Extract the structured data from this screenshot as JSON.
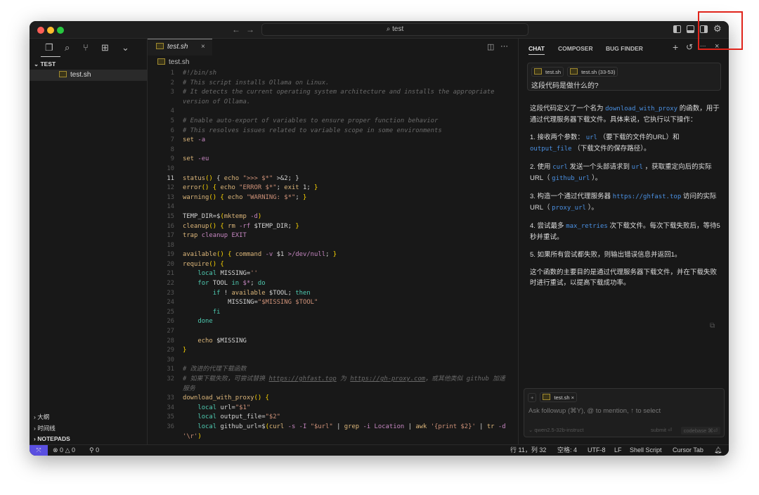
{
  "titlebar": {
    "search": "test",
    "search_icon": "search-icon"
  },
  "sidebar": {
    "section": "TEST",
    "file": "test.sh",
    "bottom": [
      "大纲",
      "时间线",
      "NOTEPADS"
    ]
  },
  "editor": {
    "tab": "test.sh",
    "breadcrumb": "test.sh",
    "current_line": 11,
    "lines": [
      {
        "n": 1,
        "t": [
          [
            "c",
            "#!/bin/sh"
          ]
        ]
      },
      {
        "n": 2,
        "t": [
          [
            "c",
            "# This script installs Ollama on Linux."
          ]
        ]
      },
      {
        "n": 3,
        "t": [
          [
            "c",
            "# It detects the current operating system architecture and installs the appropriate version of Ollama."
          ]
        ]
      },
      {
        "n": 4,
        "t": []
      },
      {
        "n": 5,
        "t": [
          [
            "c",
            "# Enable auto-export of variables to ensure proper function behavior"
          ]
        ]
      },
      {
        "n": 6,
        "t": [
          [
            "c",
            "# This resolves issues related to variable scope in some environments"
          ]
        ]
      },
      {
        "n": 7,
        "t": [
          [
            "f",
            "set "
          ],
          [
            "k",
            "-a"
          ]
        ]
      },
      {
        "n": 8,
        "t": []
      },
      {
        "n": 9,
        "t": [
          [
            "f",
            "set "
          ],
          [
            "k",
            "-eu"
          ]
        ]
      },
      {
        "n": 10,
        "t": []
      },
      {
        "n": 11,
        "t": [
          [
            "f",
            "status"
          ],
          [
            "b",
            "()"
          ],
          [
            "p",
            " { "
          ],
          [
            "f",
            "echo "
          ],
          [
            "s",
            "\">>> $*\""
          ],
          [
            "p",
            " >&2; }"
          ]
        ]
      },
      {
        "n": 12,
        "t": [
          [
            "f",
            "error"
          ],
          [
            "b",
            "()"
          ],
          [
            "b",
            " { "
          ],
          [
            "f",
            "echo "
          ],
          [
            "s",
            "\"ERROR $*\""
          ],
          [
            "p",
            "; "
          ],
          [
            "f",
            "exit "
          ],
          [
            "p",
            "1; "
          ],
          [
            "b",
            "}"
          ]
        ]
      },
      {
        "n": 13,
        "t": [
          [
            "f",
            "warning"
          ],
          [
            "b",
            "()"
          ],
          [
            "b",
            " { "
          ],
          [
            "f",
            "echo "
          ],
          [
            "s",
            "\"WARNING: $*\""
          ],
          [
            "p",
            "; "
          ],
          [
            "b",
            "}"
          ]
        ]
      },
      {
        "n": 14,
        "t": []
      },
      {
        "n": 15,
        "t": [
          [
            "p",
            "TEMP_DIR=$"
          ],
          [
            "b",
            "("
          ],
          [
            "f",
            "mktemp "
          ],
          [
            "k",
            "-d"
          ],
          [
            "b",
            ")"
          ]
        ]
      },
      {
        "n": 16,
        "t": [
          [
            "f",
            "cleanup"
          ],
          [
            "b",
            "()"
          ],
          [
            "b",
            " { "
          ],
          [
            "f",
            "rm "
          ],
          [
            "k",
            "-rf "
          ],
          [
            "p",
            "$TEMP_DIR; "
          ],
          [
            "b",
            "}"
          ]
        ]
      },
      {
        "n": 17,
        "t": [
          [
            "f",
            "trap "
          ],
          [
            "k",
            "cleanup EXIT"
          ]
        ]
      },
      {
        "n": 18,
        "t": []
      },
      {
        "n": 19,
        "t": [
          [
            "f",
            "available"
          ],
          [
            "b",
            "()"
          ],
          [
            "b",
            " { "
          ],
          [
            "f",
            "command "
          ],
          [
            "k",
            "-v "
          ],
          [
            "p",
            "$1 "
          ],
          [
            "k",
            ">/dev/null"
          ],
          [
            "p",
            "; "
          ],
          [
            "b",
            "}"
          ]
        ]
      },
      {
        "n": 20,
        "t": [
          [
            "f",
            "require"
          ],
          [
            "b",
            "()"
          ],
          [
            "b",
            " {"
          ]
        ]
      },
      {
        "n": 21,
        "t": [
          [
            "p",
            "    "
          ],
          [
            "t",
            "local "
          ],
          [
            "p",
            "MISSING="
          ],
          [
            "s",
            "''"
          ]
        ]
      },
      {
        "n": 22,
        "t": [
          [
            "p",
            "    "
          ],
          [
            "t",
            "for "
          ],
          [
            "p",
            "TOOL "
          ],
          [
            "t",
            "in "
          ],
          [
            "k",
            "$*"
          ],
          [
            "p",
            "; "
          ],
          [
            "t",
            "do"
          ]
        ]
      },
      {
        "n": 23,
        "t": [
          [
            "p",
            "        "
          ],
          [
            "t",
            "if "
          ],
          [
            "p",
            "! "
          ],
          [
            "f",
            "available "
          ],
          [
            "p",
            "$TOOL; "
          ],
          [
            "t",
            "then"
          ]
        ]
      },
      {
        "n": 24,
        "t": [
          [
            "p",
            "            MISSING="
          ],
          [
            "s",
            "\"$MISSING $TOOL\""
          ]
        ]
      },
      {
        "n": 25,
        "t": [
          [
            "p",
            "        "
          ],
          [
            "t",
            "fi"
          ]
        ]
      },
      {
        "n": 26,
        "t": [
          [
            "p",
            "    "
          ],
          [
            "t",
            "done"
          ]
        ]
      },
      {
        "n": 27,
        "t": []
      },
      {
        "n": 28,
        "t": [
          [
            "p",
            "    "
          ],
          [
            "f",
            "echo "
          ],
          [
            "p",
            "$MISSING"
          ]
        ]
      },
      {
        "n": 29,
        "t": [
          [
            "b",
            "}"
          ]
        ]
      },
      {
        "n": 30,
        "t": []
      },
      {
        "n": 31,
        "t": [
          [
            "c",
            "# 改进的代理下载函数"
          ]
        ]
      },
      {
        "n": 32,
        "t": [
          [
            "c",
            "# 如果下载失败，可尝试替换 "
          ],
          [
            "u",
            "https://ghfast.top"
          ],
          [
            "c",
            " 为 "
          ],
          [
            "u",
            "https://gh-proxy.com"
          ],
          [
            "c",
            "，或其他类似 github 加速服务"
          ]
        ]
      },
      {
        "n": 33,
        "t": [
          [
            "f",
            "download_with_proxy"
          ],
          [
            "b",
            "()"
          ],
          [
            "b",
            " {"
          ]
        ]
      },
      {
        "n": 34,
        "t": [
          [
            "p",
            "    "
          ],
          [
            "t",
            "local "
          ],
          [
            "p",
            "url="
          ],
          [
            "s",
            "\"$1\""
          ]
        ]
      },
      {
        "n": 35,
        "t": [
          [
            "p",
            "    "
          ],
          [
            "t",
            "local "
          ],
          [
            "p",
            "output_file="
          ],
          [
            "s",
            "\"$2\""
          ]
        ]
      },
      {
        "n": 36,
        "t": [
          [
            "p",
            "    "
          ],
          [
            "t",
            "local "
          ],
          [
            "p",
            "github_url=$"
          ],
          [
            "b",
            "("
          ],
          [
            "f",
            "curl "
          ],
          [
            "k",
            "-s -I "
          ],
          [
            "s",
            "\"$url\""
          ],
          [
            "p",
            " | "
          ],
          [
            "f",
            "grep "
          ],
          [
            "k",
            "-i Location"
          ],
          [
            "p",
            " | "
          ],
          [
            "f",
            "awk "
          ],
          [
            "s",
            "'{print $2}'"
          ],
          [
            "p",
            " | "
          ],
          [
            "f",
            "tr "
          ],
          [
            "k",
            "-d "
          ],
          [
            "s",
            "'\\r'"
          ],
          [
            "b",
            ")"
          ]
        ]
      }
    ]
  },
  "chat": {
    "tabs": [
      "CHAT",
      "COMPOSER",
      "BUG FINDER"
    ],
    "active_tab": "CHAT",
    "question": {
      "chips": [
        "test.sh",
        "test.sh (33-53)"
      ],
      "text": "这段代码是做什么的?"
    },
    "answer": [
      [
        [
          "t",
          "这段代码定义了一个名为 "
        ],
        [
          "c",
          "download_with_proxy"
        ],
        [
          "t",
          " 的函数，用于通过代理服务器下载文件。具体来说，它执行以下操作："
        ]
      ],
      [
        [
          "t",
          "1. 接收两个参数： "
        ],
        [
          "c",
          "url"
        ],
        [
          "t",
          " （要下载的文件的URL）和 "
        ],
        [
          "c",
          "output_file"
        ],
        [
          "t",
          " （下载文件的保存路径）。"
        ]
      ],
      [
        [
          "t",
          "2. 使用 "
        ],
        [
          "c",
          "curl"
        ],
        [
          "t",
          " 发送一个头部请求到 "
        ],
        [
          "c",
          "url"
        ],
        [
          "t",
          " ，获取重定向后的实际URL（ "
        ],
        [
          "c",
          "github_url"
        ],
        [
          "t",
          " ）。"
        ]
      ],
      [
        [
          "t",
          "3. 构造一个通过代理服务器 "
        ],
        [
          "c",
          "https://ghfast.top"
        ],
        [
          "t",
          " 访问的实际URL（ "
        ],
        [
          "c",
          "proxy_url"
        ],
        [
          "t",
          " ）。"
        ]
      ],
      [
        [
          "t",
          "4. 尝试最多 "
        ],
        [
          "c",
          "max_retries"
        ],
        [
          "t",
          " 次下载文件。每次下载失败后，等待5秒并重试。"
        ]
      ],
      [
        [
          "t",
          "5. 如果所有尝试都失败，则输出错误信息并返回1。"
        ]
      ],
      [
        [
          "t",
          "这个函数的主要目的是通过代理服务器下载文件，并在下载失败时进行重试，以提高下载成功率。"
        ]
      ]
    ],
    "input": {
      "chip": "test.sh",
      "placeholder": "Ask followup (⌘Y), @ to mention, ↑ to select",
      "model": "qwen2.5-32b-instruct",
      "submit": "submit ⏎",
      "codebase": "codebase ⌘⏎"
    }
  },
  "status": {
    "errors": "0",
    "warnings": "0",
    "ports": "0",
    "position": "行 11，列 32",
    "spaces": "空格: 4",
    "encoding": "UTF-8",
    "eol": "LF",
    "language": "Shell Script",
    "cursor_tab": "Cursor Tab"
  }
}
